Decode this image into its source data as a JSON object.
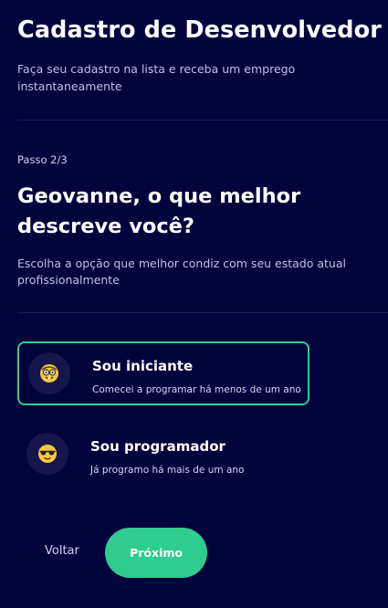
{
  "header": {
    "title": "Cadastro de Desenvolvedor",
    "subtitle": "Faça seu cadastro na lista e receba um emprego instantaneamente"
  },
  "step": {
    "label": "Passo 2/3",
    "title": "Geovanne, o que melhor descreve você?",
    "subtitle": "Escolha a opção que melhor condiz com seu estado atual profissionalmente"
  },
  "options": [
    {
      "icon": "nerd-face-emoji",
      "title": "Sou iniciante",
      "description": "Comecei a programar há menos de um ano",
      "selected": true
    },
    {
      "icon": "sunglasses-face-emoji",
      "title": "Sou programador",
      "description": "Já programo há mais de um ano",
      "selected": false
    }
  ],
  "actions": {
    "back_label": "Voltar",
    "next_label": "Próximo"
  },
  "colors": {
    "background": "#02023d",
    "accent": "#2ecc8f",
    "icon_background": "#16164d",
    "muted_text": "#bfc0ea"
  }
}
